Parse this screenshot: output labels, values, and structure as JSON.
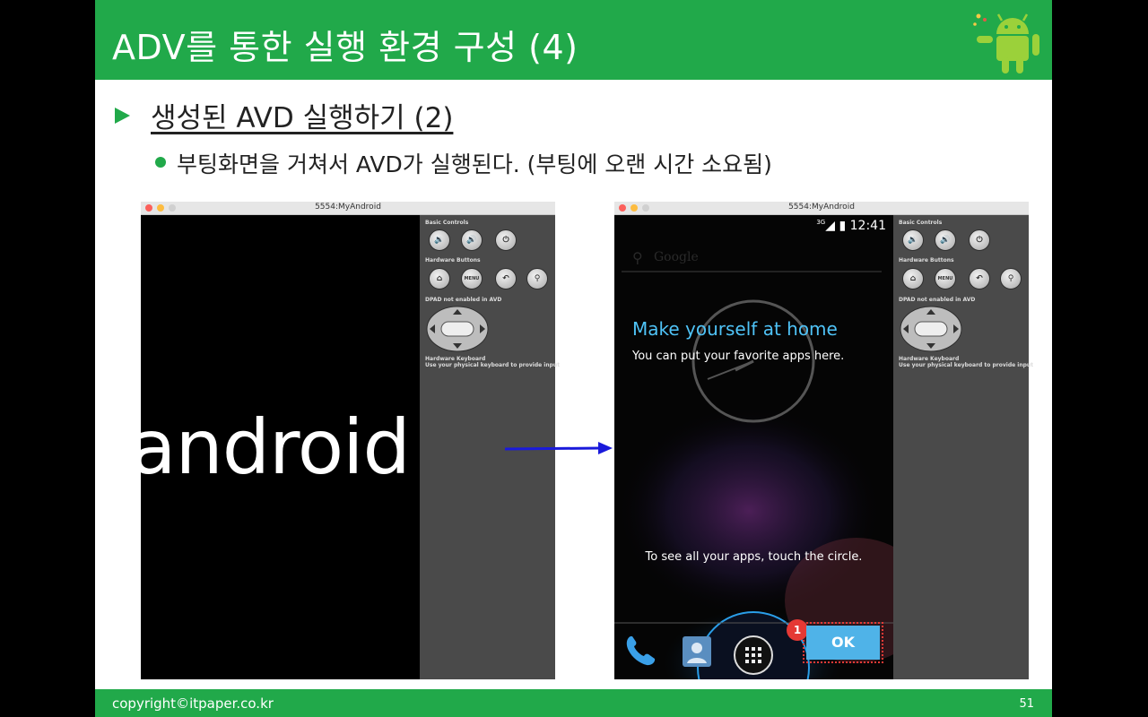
{
  "slide": {
    "title": "ADV를 통한 실행 환경 구성 (4)",
    "heading": "생성된 AVD 실행하기 (2)",
    "bullet": "부팅화면을 거쳐서 AVD가 실행된다. (부팅에 오랜 시간 소요됨)",
    "footer_copyright": "copyright©itpaper.co.kr",
    "page_number": "51",
    "accent_color": "#21a94a"
  },
  "emulator_left": {
    "window_title": "5554:MyAndroid",
    "boot_logo_text": "android",
    "panel": {
      "basic_controls": "Basic Controls",
      "hardware_buttons": "Hardware Buttons",
      "menu_label": "MENU",
      "dpad": "DPAD not enabled in AVD",
      "hw_keyboard": "Hardware Keyboard",
      "hw_keyboard_hint": "Use your physical keyboard to provide input"
    }
  },
  "emulator_right": {
    "window_title": "5554:MyAndroid",
    "status_network": "3G",
    "status_time": "12:41",
    "google_search": "Google",
    "welcome_title": "Make yourself at home",
    "welcome_sub": "You can put your favorite apps here.",
    "hint": "To see all your apps, touch the circle.",
    "ok_button": "OK",
    "badge_number": "1",
    "panel": {
      "basic_controls": "Basic Controls",
      "hardware_buttons": "Hardware Buttons",
      "menu_label": "MENU",
      "dpad": "DPAD not enabled in AVD",
      "hw_keyboard": "Hardware Keyboard",
      "hw_keyboard_hint": "Use your physical keyboard to provide input"
    }
  }
}
